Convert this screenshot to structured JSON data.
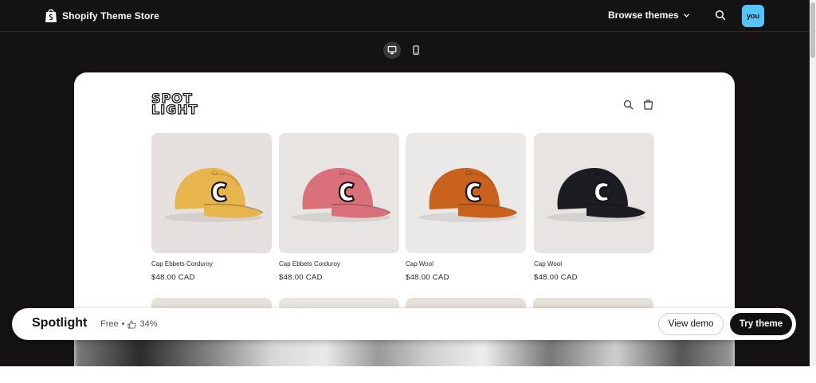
{
  "header": {
    "brand_label": "Shopify Theme Store",
    "browse_label": "Browse themes",
    "avatar_label": "you"
  },
  "device_toggle": {
    "desktop_icon": "desktop-icon",
    "mobile_icon": "mobile-icon",
    "active": "desktop"
  },
  "preview": {
    "logo_line1": "SPOT",
    "logo_line2": "LIGHT",
    "products": [
      {
        "name": "Cap Ebbets Corduroy",
        "price": "$48.00 CAD",
        "color": "#e8b54d"
      },
      {
        "name": "Cap Ebbets Corduroy",
        "price": "$48.00 CAD",
        "color": "#d9707a"
      },
      {
        "name": "Cap Wool",
        "price": "$48.00 CAD",
        "color": "#c9621c"
      },
      {
        "name": "Cap Wool",
        "price": "$48.00 CAD",
        "color": "#1c1d22"
      }
    ]
  },
  "theme_bar": {
    "name": "Spotlight",
    "price": "Free",
    "separator": "•",
    "rating": "34%",
    "view_demo_label": "View demo",
    "try_theme_label": "Try theme"
  },
  "colors": {
    "app_background": "#141213",
    "avatar": "#54c5f8",
    "primary_button": "#111111"
  }
}
